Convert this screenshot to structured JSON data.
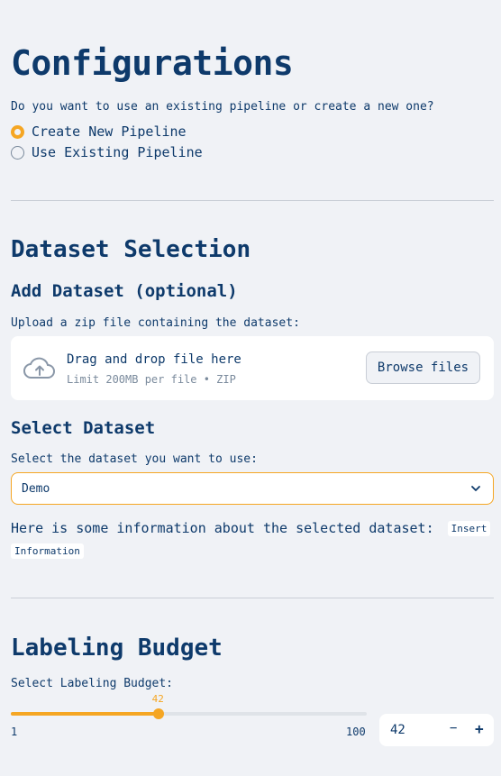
{
  "page": {
    "title": "Configurations",
    "pipeline_question": "Do you want to use an existing pipeline or create a new one?",
    "pipeline_options": [
      "Create New Pipeline",
      "Use Existing Pipeline"
    ],
    "pipeline_selected": "Create New Pipeline"
  },
  "dataset_section": {
    "title": "Dataset Selection",
    "add_title": "Add Dataset (optional)",
    "upload_label": "Upload a zip file containing the dataset:",
    "dropzone_main": "Drag and drop file here",
    "dropzone_sub": "Limit 200MB per file • ZIP",
    "browse_label": "Browse files",
    "select_title": "Select Dataset",
    "select_label": "Select the dataset you want to use:",
    "select_value": "Demo",
    "info_text": "Here is some information about the selected dataset:",
    "info_code_1": "Insert",
    "info_code_2": "Information"
  },
  "budget_section": {
    "title": "Labeling Budget",
    "label": "Select Labeling Budget:",
    "slider_min": "1",
    "slider_max": "100",
    "slider_value": 42,
    "slider_value_text": "42",
    "number_value": "42",
    "minus_label": "−",
    "plus_label": "+"
  },
  "colors": {
    "accent": "#f5a623",
    "text": "#0e3a6b",
    "background": "#f0f2f6"
  },
  "icons": {
    "upload": "cloud-upload-icon",
    "dropdown": "chevron-down-icon"
  }
}
